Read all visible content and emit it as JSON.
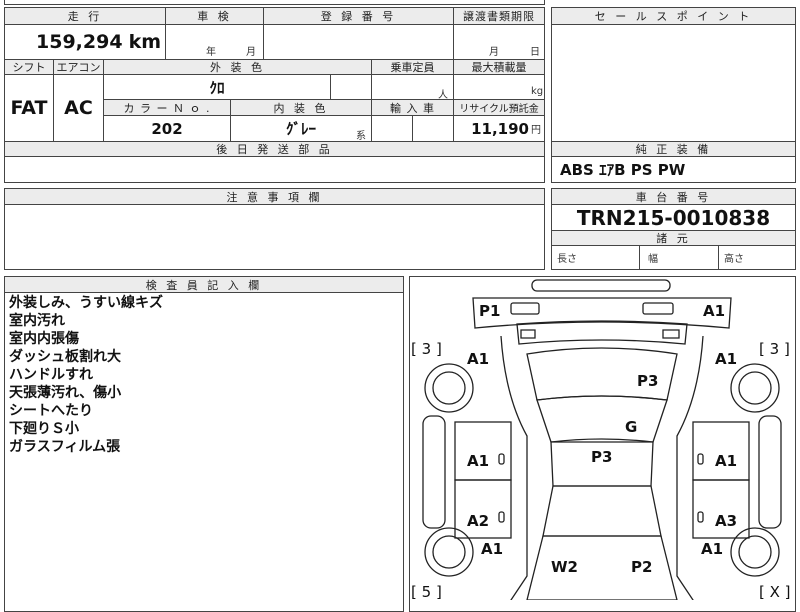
{
  "header": {
    "mileage_label": "走 行",
    "inspection_label": "車 検",
    "registration_label": "登 録 番 号",
    "transfer_label": "譲渡書類期限",
    "selling_points_label": "セ ー ル ス ポ イ ン ト"
  },
  "mileage": {
    "value": "159,294",
    "unit": "km"
  },
  "inspection": {
    "year_unit": "年",
    "month_unit": "月"
  },
  "transfer": {
    "month_unit": "月",
    "day_unit": "日"
  },
  "spec": {
    "shift_label": "シフト",
    "ac_label": "エアコン",
    "color_label": "外 装 色",
    "capacity_label": "乗車定員",
    "load_label": "最大積載量",
    "shift": "FAT",
    "ac": "AC",
    "color": "ｸﾛ",
    "capacity_unit": "人",
    "load_unit": "kg",
    "color_no_label": "カ ラ ー Ｎ ｏ .",
    "interior_label": "内 装 色",
    "import_label": "輸 入 車",
    "recycle_label": "リサイクル預託金",
    "color_no": "202",
    "interior": "ｸﾞﾚｰ",
    "interior_suffix": "系",
    "recycle": "11,190",
    "recycle_unit": "円"
  },
  "later_parts_label": "後 日 発 送 部 品",
  "equipment": {
    "label": "純 正 装 備",
    "value": "ABS ｴｱB PS PW"
  },
  "caution_label": "注 意 事 項 欄",
  "chassis": {
    "label": "車 台 番 号",
    "value": "TRN215-0010838"
  },
  "dimensions": {
    "label": "諸 元",
    "length": "長さ",
    "width": "幅",
    "height": "高さ"
  },
  "inspector": {
    "label": "検 査 員 記 入 欄",
    "notes": [
      "外装しみ、うすい線キズ",
      "室内汚れ",
      "室内内張傷",
      "ダッシュ板割れ大",
      "ハンドルすれ",
      "天張薄汚れ、傷小",
      "シートへたり",
      "下廻りＳ小",
      "ガラスフィルム張"
    ]
  },
  "diagram": {
    "marks": [
      "P1",
      "A1",
      "A1",
      "A1",
      "P3",
      "G",
      "A1",
      "P3",
      "A1",
      "A2",
      "A3",
      "A1",
      "A1",
      "W2",
      "P2"
    ],
    "tires": [
      "3",
      "3",
      "5",
      "X"
    ]
  }
}
